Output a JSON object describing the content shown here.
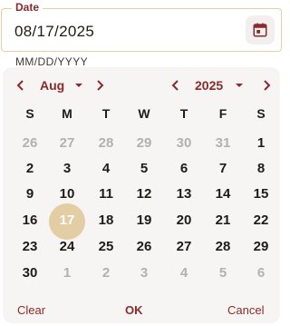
{
  "field": {
    "label": "Date",
    "value": "08/17/2025",
    "hint": "MM/DD/YYYY",
    "icon": "calendar-icon"
  },
  "nav": {
    "month": "Aug",
    "year": "2025"
  },
  "weekdays": [
    "S",
    "M",
    "T",
    "W",
    "T",
    "F",
    "S"
  ],
  "weeks": [
    [
      {
        "d": "26",
        "muted": true
      },
      {
        "d": "27",
        "muted": true
      },
      {
        "d": "28",
        "muted": true
      },
      {
        "d": "29",
        "muted": true
      },
      {
        "d": "30",
        "muted": true
      },
      {
        "d": "31",
        "muted": true
      },
      {
        "d": "1"
      }
    ],
    [
      {
        "d": "2"
      },
      {
        "d": "3"
      },
      {
        "d": "4"
      },
      {
        "d": "5"
      },
      {
        "d": "6"
      },
      {
        "d": "7"
      },
      {
        "d": "8"
      }
    ],
    [
      {
        "d": "9"
      },
      {
        "d": "10"
      },
      {
        "d": "11"
      },
      {
        "d": "12"
      },
      {
        "d": "13"
      },
      {
        "d": "14"
      },
      {
        "d": "15"
      }
    ],
    [
      {
        "d": "16"
      },
      {
        "d": "17",
        "selected": true
      },
      {
        "d": "18"
      },
      {
        "d": "19"
      },
      {
        "d": "20"
      },
      {
        "d": "21"
      },
      {
        "d": "22"
      }
    ],
    [
      {
        "d": "23"
      },
      {
        "d": "24"
      },
      {
        "d": "25"
      },
      {
        "d": "26"
      },
      {
        "d": "27"
      },
      {
        "d": "28"
      },
      {
        "d": "29"
      }
    ],
    [
      {
        "d": "30"
      },
      {
        "d": "1",
        "muted": true
      },
      {
        "d": "2",
        "muted": true
      },
      {
        "d": "3",
        "muted": true
      },
      {
        "d": "4",
        "muted": true
      },
      {
        "d": "5",
        "muted": true
      },
      {
        "d": "6",
        "muted": true
      }
    ]
  ],
  "actions": {
    "clear": "Clear",
    "ok": "OK",
    "cancel": "Cancel"
  },
  "colors": {
    "accent": "#8b2a2a",
    "selected": "#e2cda5",
    "border": "#e3cfa6"
  }
}
